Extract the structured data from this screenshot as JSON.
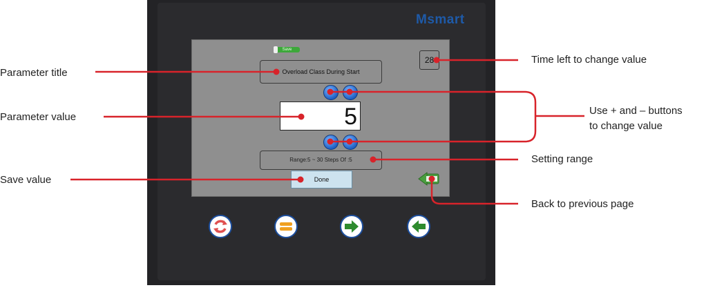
{
  "device": {
    "brand": "Msmart",
    "screen": {
      "save_label": "Save",
      "timer": "28",
      "parameter_title": "Overload Class During Start",
      "parameter_value": "5",
      "plus_symbol": "+",
      "minus_symbol": "−",
      "range_text": "Range:5 ~ 30   Steps Of :5",
      "done_label": "Done",
      "back_icon": "back-arrow-icon"
    },
    "hardware_buttons": [
      "refresh-icon",
      "menu-icon",
      "right-arrow-icon",
      "left-arrow-icon"
    ]
  },
  "annotations": {
    "parameter_title": "Parameter title",
    "parameter_value": "Parameter value",
    "save_value": "Save value",
    "time_left": "Time left to change value",
    "use_buttons_line1": "Use + and – buttons",
    "use_buttons_line2": "to change value",
    "setting_range": "Setting range",
    "back_page": "Back to previous page"
  },
  "colors": {
    "callout": "#d8232a",
    "brand": "#1e5aa8",
    "screen": "#8f8f8f",
    "button_blue": "#1e5fc4",
    "done_button": "#cde3ef"
  }
}
